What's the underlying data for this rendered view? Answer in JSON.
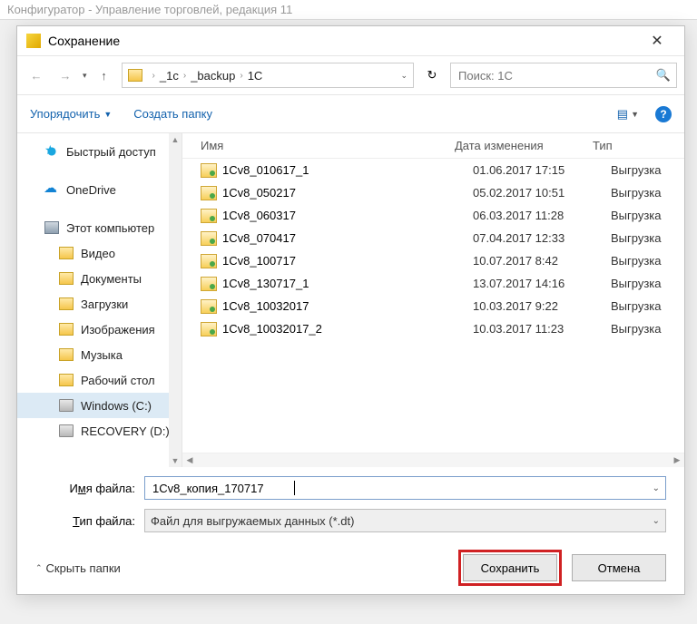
{
  "parent_window": {
    "title": "Конфигуратор - Управление торговлей, редакция 11"
  },
  "dialog": {
    "title": "Сохранение"
  },
  "breadcrumb": {
    "segments": [
      "_1c",
      "_backup",
      "1C"
    ]
  },
  "search": {
    "placeholder": "Поиск: 1C"
  },
  "toolbar": {
    "organize": "Упорядочить",
    "new_folder": "Создать папку"
  },
  "columns": {
    "name": "Имя",
    "date": "Дата изменения",
    "type": "Тип"
  },
  "sidebar": {
    "items": [
      {
        "label": "Быстрый доступ",
        "icon": "ic-star",
        "sub": false
      },
      {
        "label": "OneDrive",
        "icon": "ic-cloud",
        "sub": false
      },
      {
        "label": "Этот компьютер",
        "icon": "ic-pc",
        "sub": false
      },
      {
        "label": "Видео",
        "icon": "ic-fold",
        "sub": true
      },
      {
        "label": "Документы",
        "icon": "ic-fold",
        "sub": true
      },
      {
        "label": "Загрузки",
        "icon": "ic-fold",
        "sub": true
      },
      {
        "label": "Изображения",
        "icon": "ic-fold",
        "sub": true
      },
      {
        "label": "Музыка",
        "icon": "ic-fold",
        "sub": true
      },
      {
        "label": "Рабочий стол",
        "icon": "ic-fold",
        "sub": true
      },
      {
        "label": "Windows (C:)",
        "icon": "ic-drive",
        "sub": true,
        "selected": true
      },
      {
        "label": "RECOVERY (D:)",
        "icon": "ic-drive",
        "sub": true
      }
    ]
  },
  "files": [
    {
      "name": "1Cv8_010617_1",
      "date": "01.06.2017 17:15",
      "type": "Выгрузка"
    },
    {
      "name": "1Cv8_050217",
      "date": "05.02.2017 10:51",
      "type": "Выгрузка"
    },
    {
      "name": "1Cv8_060317",
      "date": "06.03.2017 11:28",
      "type": "Выгрузка"
    },
    {
      "name": "1Cv8_070417",
      "date": "07.04.2017 12:33",
      "type": "Выгрузка"
    },
    {
      "name": "1Cv8_100717",
      "date": "10.07.2017 8:42",
      "type": "Выгрузка"
    },
    {
      "name": "1Cv8_130717_1",
      "date": "13.07.2017 14:16",
      "type": "Выгрузка"
    },
    {
      "name": "1Cv8_10032017",
      "date": "10.03.2017 9:22",
      "type": "Выгрузка"
    },
    {
      "name": "1Cv8_10032017_2",
      "date": "10.03.2017 11:23",
      "type": "Выгрузка"
    }
  ],
  "form": {
    "filename_label_pre": "И",
    "filename_label_u": "м",
    "filename_label_post": "я файла:",
    "filename_value": "1Cv8_копия_170717",
    "filetype_label_pre": "",
    "filetype_label_u": "Т",
    "filetype_label_post": "ип файла:",
    "filetype_value": "Файл для выгружаемых данных (*.dt)"
  },
  "footer": {
    "hide_folders": "Скрыть папки",
    "save_pre": "Со",
    "save_u": "х",
    "save_post": "ранить",
    "cancel": "Отмена"
  },
  "help_char": "?"
}
